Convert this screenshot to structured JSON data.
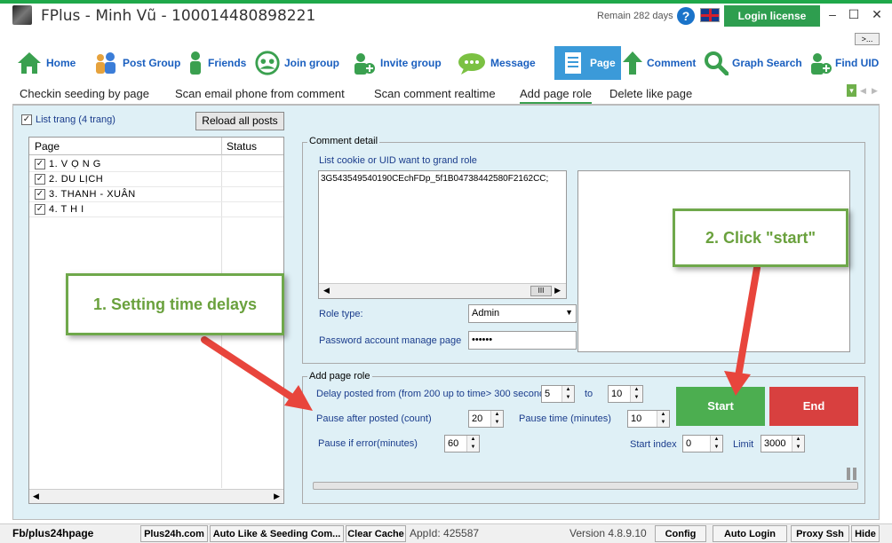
{
  "window": {
    "title": "FPlus - Minh Vũ - 100014480898221",
    "remain": "Remain 282 days",
    "help_icon": "?",
    "login_button": "Login license",
    "minimize": "–",
    "maximize": "☐",
    "close": "✕",
    "more_button": ">..."
  },
  "toolbar": [
    {
      "label": "Home",
      "icon": "home-icon"
    },
    {
      "label": "Post Group",
      "icon": "users-icon"
    },
    {
      "label": "Friends",
      "icon": "person-icon"
    },
    {
      "label": "Join group",
      "icon": "join-group-icon"
    },
    {
      "label": "Invite group",
      "icon": "invite-icon"
    },
    {
      "label": "Message",
      "icon": "message-icon"
    },
    {
      "label": "Page",
      "icon": "page-icon",
      "active": true
    },
    {
      "label": "Comment",
      "icon": "up-arrow-icon"
    },
    {
      "label": "Graph Search",
      "icon": "search-icon"
    },
    {
      "label": "Find UID",
      "icon": "find-uid-icon"
    }
  ],
  "subtabs": [
    {
      "label": "Checkin seeding by page"
    },
    {
      "label": "Scan email phone from comment"
    },
    {
      "label": "Scan comment realtime"
    },
    {
      "label": "Add page role",
      "active": true
    },
    {
      "label": "Delete like page"
    }
  ],
  "left": {
    "list_check_label": "List trang (4 trang)",
    "reload_button": "Reload all posts",
    "col_page": "Page",
    "col_status": "Status",
    "pages": [
      "1. V Ọ N G",
      "2. DU LỊCH",
      "3. THANH - XUÂN",
      "4. T H I"
    ]
  },
  "comment_detail": {
    "legend": "Comment detail",
    "cookie_label": "List cookie or UID want to grand role",
    "cookie_value": "3G543549540190CEchFDp_5f1B04738442580F2162CC;",
    "role_label": "Role type:",
    "role_value": "Admin",
    "password_label": "Password account manage page",
    "password_value": "••••••"
  },
  "add_page_role": {
    "legend": "Add page role",
    "delay_label": "Delay posted from (from 200 up to time> 300 seconds)",
    "delay_from": "5",
    "to_label": "to",
    "delay_to": "10",
    "pause_after_label": "Pause after posted (count)",
    "pause_after": "20",
    "pause_time_label": "Pause time (minutes)",
    "pause_time": "10",
    "pause_error_label": "Pause if error(minutes)",
    "pause_error": "60",
    "start_index_label": "Start index",
    "start_index": "0",
    "limit_label": "Limit",
    "limit": "3000",
    "start_button": "Start",
    "end_button": "End"
  },
  "annotations": {
    "callout1": "1. Setting time delays",
    "callout2": "2. Click \"start\""
  },
  "statusbar": {
    "page_link": "Fb/plus24hpage",
    "site": "Plus24h.com",
    "auto_like": "Auto Like & Seeding Com...",
    "clear_cache": "Clear Cache",
    "app_id": "AppId: 425587",
    "version": "Version 4.8.9.10",
    "config": "Config",
    "auto_login": "Auto Login",
    "proxy": "Proxy Ssh",
    "hide": "Hide"
  },
  "colors": {
    "accent_green": "#2e9e4f",
    "start_green": "#4cae50",
    "end_red": "#d8403f",
    "panel_bg": "#dff0f6",
    "annotation_arrow": "#e8453c"
  }
}
